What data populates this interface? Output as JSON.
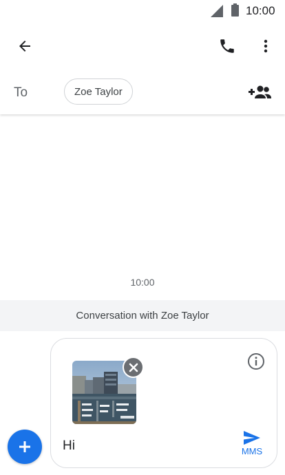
{
  "status_bar": {
    "time": "10:00"
  },
  "app_bar": {
    "back_icon": "arrow-back-icon",
    "call_icon": "phone-icon",
    "more_icon": "more-vert-icon"
  },
  "recipient": {
    "to_label": "To",
    "chip_name": "Zoe Taylor",
    "add_icon": "add-person-icon"
  },
  "conversation": {
    "time": "10:00",
    "banner": "Conversation with Zoe Taylor"
  },
  "compose": {
    "message_value": "Hi",
    "send_label": "MMS",
    "attachment_icon": "photo-thumbnail",
    "info_icon": "info-icon",
    "remove_icon": "close-icon",
    "attach_icon": "plus-icon"
  },
  "colors": {
    "accent": "#1a73e8",
    "banner_bg": "#f3f4f6",
    "icon_dark": "#202124"
  }
}
